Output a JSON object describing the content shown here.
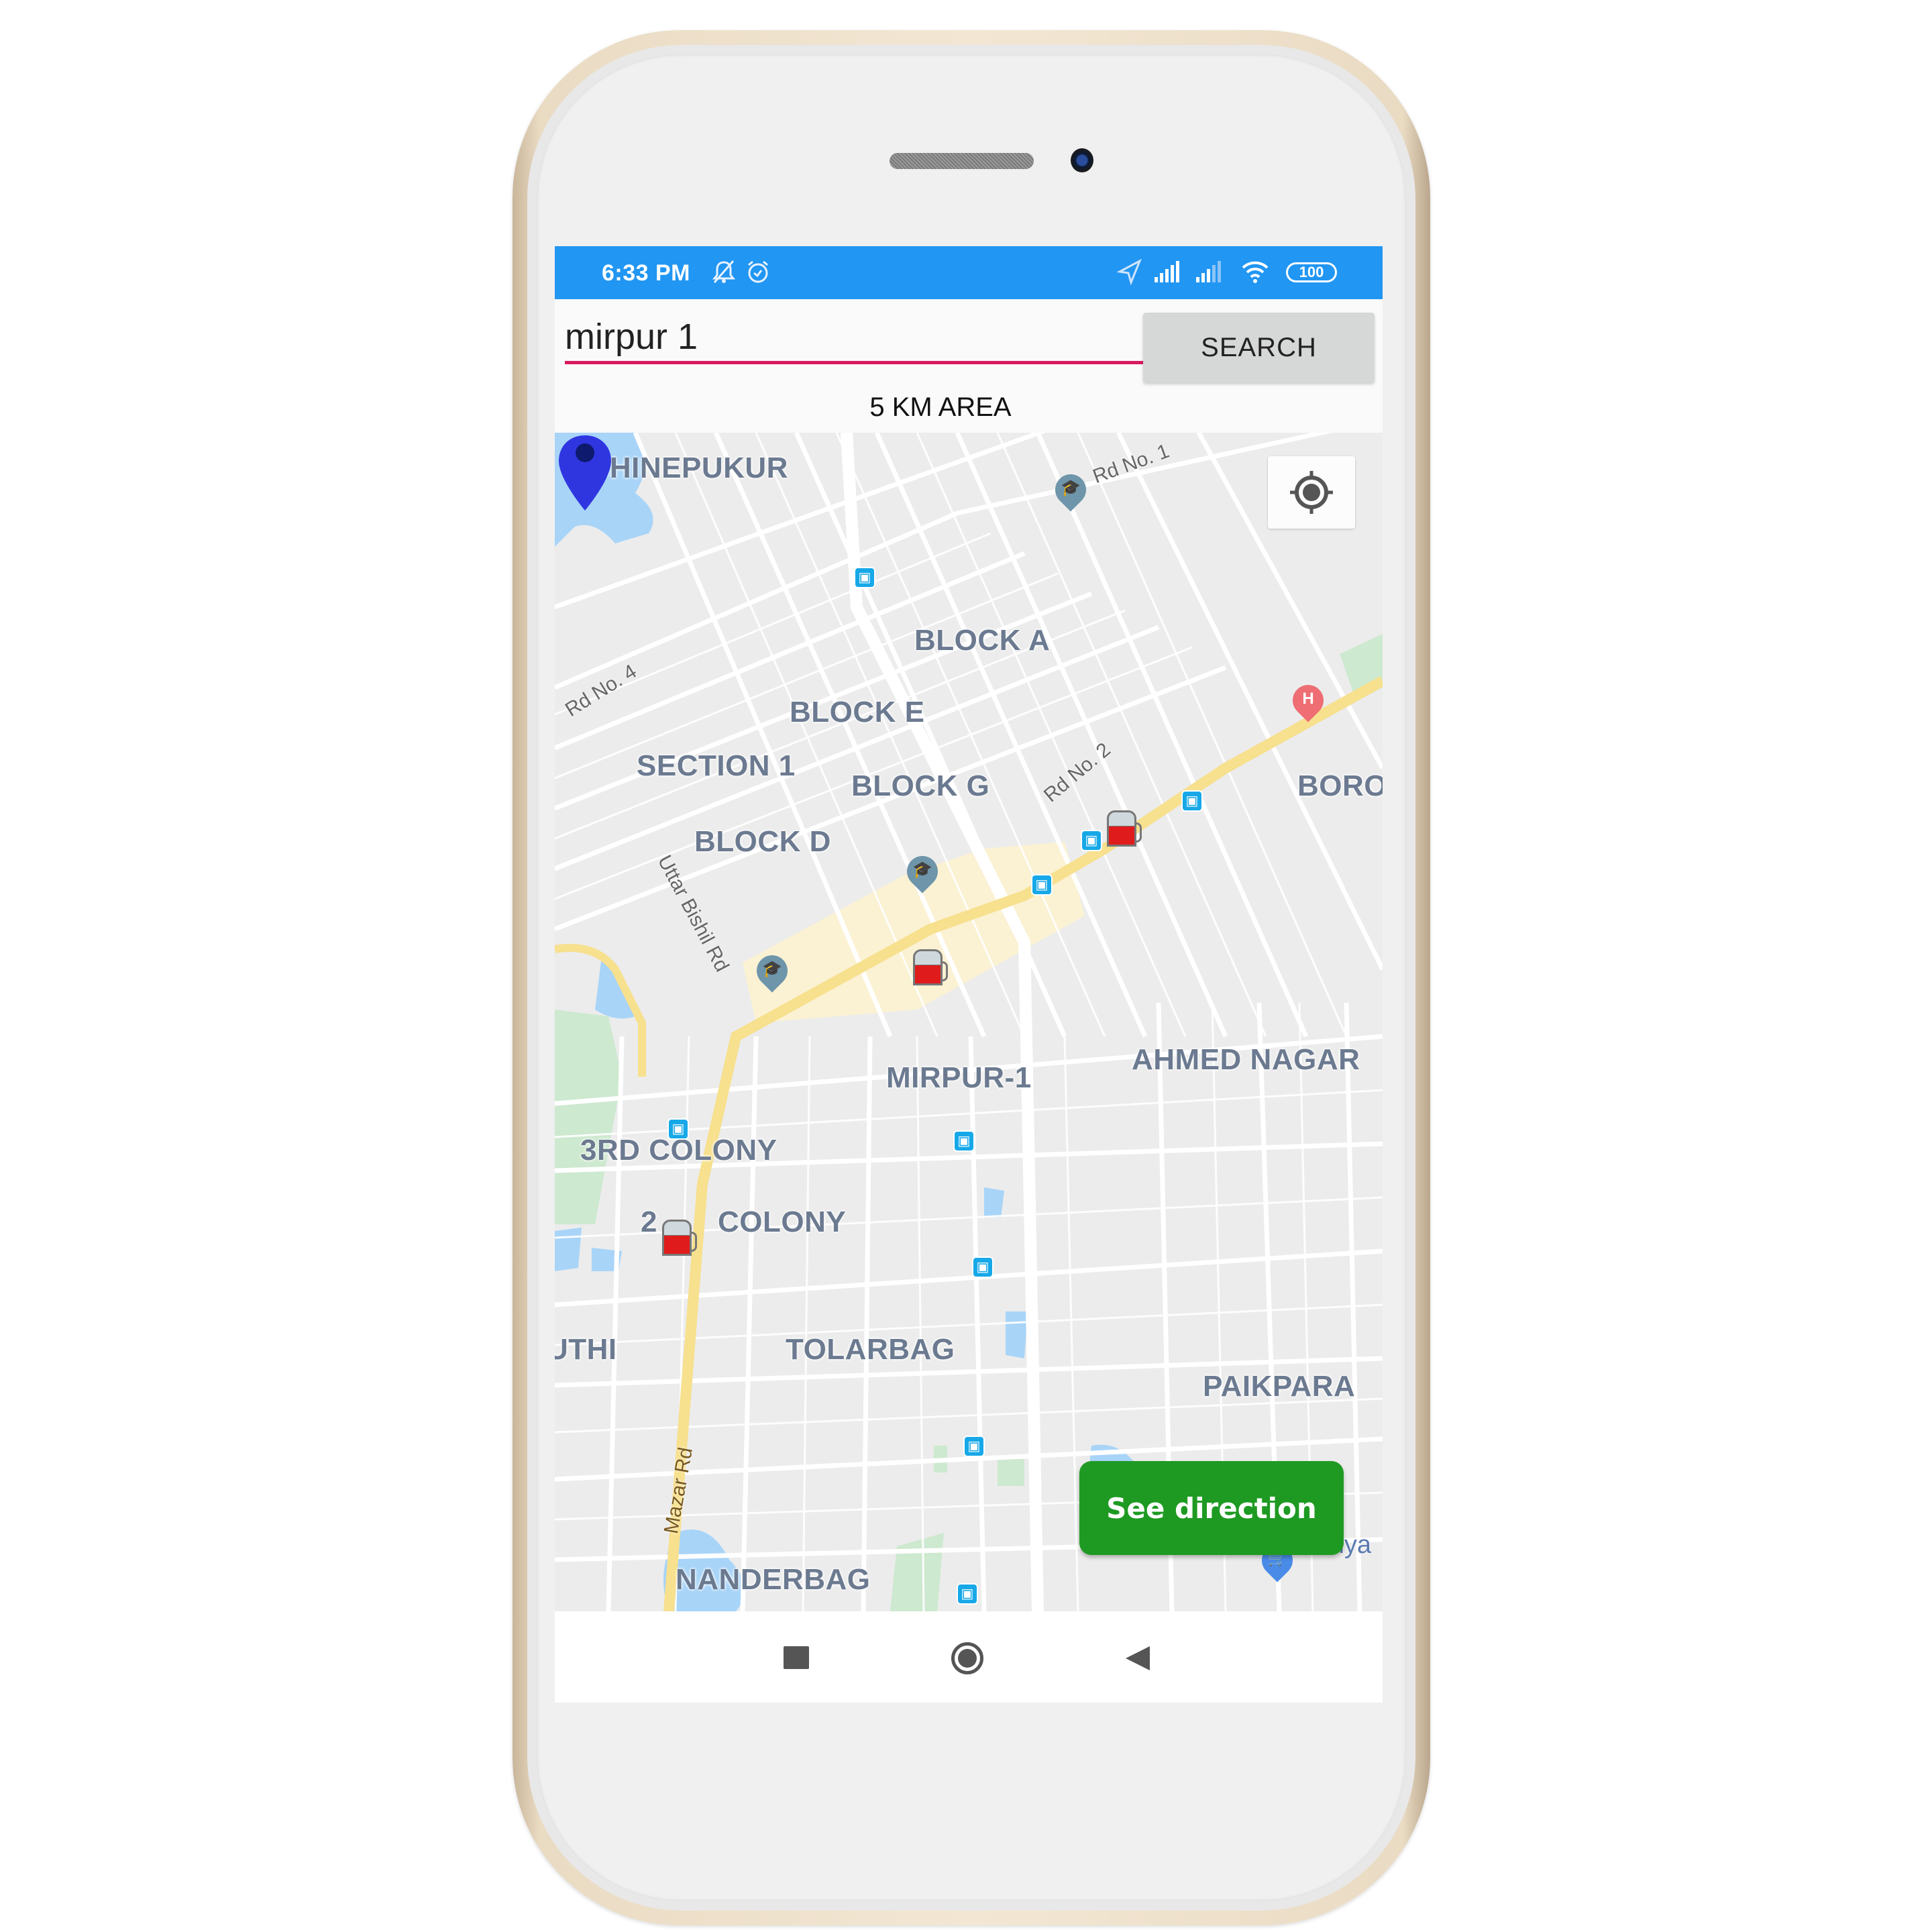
{
  "device": {
    "frame": "gold-smartphone"
  },
  "status_bar": {
    "time": "6:33 PM",
    "left_icons": [
      "notifications-off-icon",
      "alarm-icon"
    ],
    "right_icons": [
      "location-arrow-icon",
      "signal-icon",
      "signal-icon-2",
      "wifi-icon"
    ],
    "battery": "100",
    "background_color": "#2196f3"
  },
  "search": {
    "value": "mirpur 1",
    "button_label": "SEARCH",
    "underline_color": "#d81b60"
  },
  "area_label": "5 KM AREA",
  "map": {
    "places": [
      {
        "label": "SHINEPUKUR"
      },
      {
        "label": "BLOCK A"
      },
      {
        "label": "BLOCK E"
      },
      {
        "label": "SECTION 1"
      },
      {
        "label": "BLOCK G"
      },
      {
        "label": "BLOCK D"
      },
      {
        "label": "BORO"
      },
      {
        "label": "MIRPUR-1"
      },
      {
        "label": "AHMED NAGAR"
      },
      {
        "label": "3RD COLONY"
      },
      {
        "label": "2ND COLONY",
        "display": "2"
      },
      {
        "label": "COLONY"
      },
      {
        "label": "UTHI"
      },
      {
        "label": "TOLARBAG"
      },
      {
        "label": "PAIKPARA"
      },
      {
        "label": "NANDERBAG"
      },
      {
        "label": "llya"
      }
    ],
    "roads": [
      {
        "label": "Rd No. 1"
      },
      {
        "label": "Rd No. 4"
      },
      {
        "label": "Rd No. 2"
      },
      {
        "label": "Uttar Bishil Rd"
      },
      {
        "label": "Mazar Rd"
      }
    ],
    "markers": {
      "selected_location": "MIRPUR-1",
      "selected_color": "#2f36e0",
      "fuel_stations": 3,
      "bus_stops": 10,
      "school_pins": 3,
      "hospital_pin": "H",
      "shopping_pin": "cart"
    },
    "locate_button_icon": "my-location-icon"
  },
  "actions": {
    "see_direction_label": "See direction",
    "see_direction_color": "#1e9a22"
  },
  "nav_bar": {
    "buttons": [
      "recent-apps",
      "home",
      "back"
    ]
  }
}
